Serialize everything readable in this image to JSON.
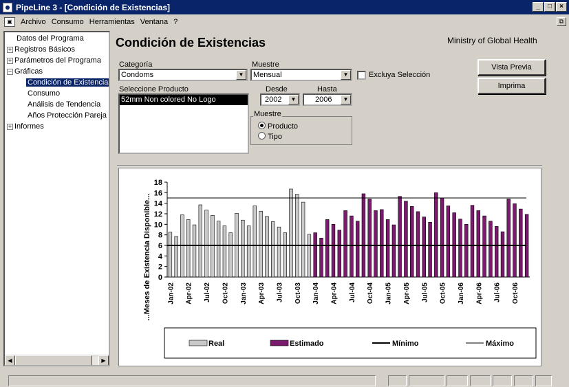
{
  "window": {
    "title": "PipeLine 3 - [Condición de Existencias]"
  },
  "menu": [
    "Archivo",
    "Consumo",
    "Herramientas",
    "Ventana",
    "?"
  ],
  "tree": [
    {
      "label": "Datos del Programa"
    },
    {
      "label": "Registros Básicos"
    },
    {
      "label": "Parámetros del Programa"
    },
    {
      "label": "Gráficas"
    },
    {
      "label": "Condición de Existencias"
    },
    {
      "label": "Consumo"
    },
    {
      "label": "Análisis de Tendencia"
    },
    {
      "label": "Años Protección Pareja (A"
    },
    {
      "label": "Informes"
    }
  ],
  "page": {
    "title": "Condición de Existencias",
    "org": "Ministry of Global Health"
  },
  "form": {
    "categoria_label": "Categoría",
    "categoria_value": "Condoms",
    "muestre_label": "Muestre",
    "muestre_value": "Mensual",
    "excluya_label": "Excluya Selección",
    "producto_label": "Seleccione Producto",
    "producto_item": "52mm Non colored No Logo",
    "desde_label": "Desde",
    "desde_value": "2002",
    "hasta_label": "Hasta",
    "hasta_value": "2006",
    "group_label": "Muestre",
    "radio_producto": "Producto",
    "radio_tipo": "Tipo"
  },
  "buttons": {
    "preview": "Vista Previa",
    "print": "Imprima"
  },
  "chart_data": {
    "type": "bar",
    "ylabel": "...Meses de Existencia Disponible...",
    "ylim": [
      0,
      18
    ],
    "yticks": [
      0,
      2,
      4,
      6,
      8,
      10,
      12,
      14,
      16,
      18
    ],
    "xtick_labels": [
      "Jan-02",
      "Apr-02",
      "Jul-02",
      "Oct-02",
      "Jan-03",
      "Apr-03",
      "Jul-03",
      "Oct-03",
      "Jan-04",
      "Apr-04",
      "Jul-04",
      "Oct-04",
      "Jan-05",
      "Apr-05",
      "Jul-05",
      "Oct-05",
      "Jan-06",
      "Apr-06",
      "Jul-06",
      "Oct-06"
    ],
    "series": [
      {
        "name": "Real",
        "color": "#c8c8c8",
        "values": [
          8.5,
          7.7,
          11.8,
          10.9,
          9.9,
          13.7,
          12.7,
          11.7,
          10.6,
          9.7,
          8.4,
          12.1,
          10.8,
          9.7,
          13.5,
          12.5,
          11.5,
          10.5,
          9.5,
          8.4,
          16.7,
          15.7,
          14.2,
          8.1
        ]
      },
      {
        "name": "Estimado",
        "color": "#7b1a6e",
        "values": [
          8.4,
          7.4,
          10.9,
          10.0,
          8.9,
          12.6,
          11.6,
          10.6,
          15.8,
          14.8,
          12.6,
          12.8,
          10.9,
          9.9,
          15.3,
          14.4,
          13.4,
          12.4,
          11.4,
          10.4,
          16.0,
          15.0,
          13.5,
          12.2,
          11.0,
          10.0,
          13.6,
          12.6,
          11.6,
          10.6,
          9.6,
          8.6,
          14.8,
          13.9,
          12.9,
          11.9
        ]
      },
      {
        "name": "Mínimo",
        "value": 6
      },
      {
        "name": "Máximo",
        "value": 15
      }
    ],
    "legend": [
      "Real",
      "Estimado",
      "Mínimo",
      "Máximo"
    ]
  }
}
